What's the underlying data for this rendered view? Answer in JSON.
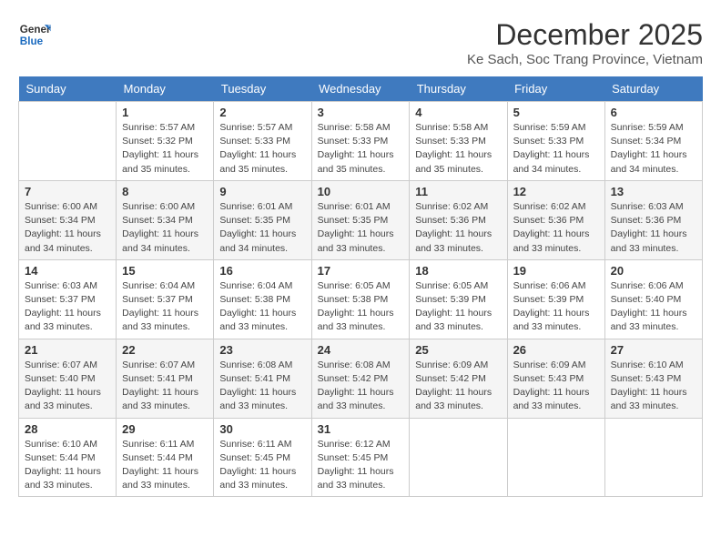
{
  "header": {
    "logo_general": "General",
    "logo_blue": "Blue",
    "month_title": "December 2025",
    "location": "Ke Sach, Soc Trang Province, Vietnam"
  },
  "weekdays": [
    "Sunday",
    "Monday",
    "Tuesday",
    "Wednesday",
    "Thursday",
    "Friday",
    "Saturday"
  ],
  "weeks": [
    [
      {
        "day": "",
        "sunrise": "",
        "sunset": "",
        "daylight": ""
      },
      {
        "day": "1",
        "sunrise": "Sunrise: 5:57 AM",
        "sunset": "Sunset: 5:32 PM",
        "daylight": "Daylight: 11 hours and 35 minutes."
      },
      {
        "day": "2",
        "sunrise": "Sunrise: 5:57 AM",
        "sunset": "Sunset: 5:33 PM",
        "daylight": "Daylight: 11 hours and 35 minutes."
      },
      {
        "day": "3",
        "sunrise": "Sunrise: 5:58 AM",
        "sunset": "Sunset: 5:33 PM",
        "daylight": "Daylight: 11 hours and 35 minutes."
      },
      {
        "day": "4",
        "sunrise": "Sunrise: 5:58 AM",
        "sunset": "Sunset: 5:33 PM",
        "daylight": "Daylight: 11 hours and 35 minutes."
      },
      {
        "day": "5",
        "sunrise": "Sunrise: 5:59 AM",
        "sunset": "Sunset: 5:33 PM",
        "daylight": "Daylight: 11 hours and 34 minutes."
      },
      {
        "day": "6",
        "sunrise": "Sunrise: 5:59 AM",
        "sunset": "Sunset: 5:34 PM",
        "daylight": "Daylight: 11 hours and 34 minutes."
      }
    ],
    [
      {
        "day": "7",
        "sunrise": "Sunrise: 6:00 AM",
        "sunset": "Sunset: 5:34 PM",
        "daylight": "Daylight: 11 hours and 34 minutes."
      },
      {
        "day": "8",
        "sunrise": "Sunrise: 6:00 AM",
        "sunset": "Sunset: 5:34 PM",
        "daylight": "Daylight: 11 hours and 34 minutes."
      },
      {
        "day": "9",
        "sunrise": "Sunrise: 6:01 AM",
        "sunset": "Sunset: 5:35 PM",
        "daylight": "Daylight: 11 hours and 34 minutes."
      },
      {
        "day": "10",
        "sunrise": "Sunrise: 6:01 AM",
        "sunset": "Sunset: 5:35 PM",
        "daylight": "Daylight: 11 hours and 33 minutes."
      },
      {
        "day": "11",
        "sunrise": "Sunrise: 6:02 AM",
        "sunset": "Sunset: 5:36 PM",
        "daylight": "Daylight: 11 hours and 33 minutes."
      },
      {
        "day": "12",
        "sunrise": "Sunrise: 6:02 AM",
        "sunset": "Sunset: 5:36 PM",
        "daylight": "Daylight: 11 hours and 33 minutes."
      },
      {
        "day": "13",
        "sunrise": "Sunrise: 6:03 AM",
        "sunset": "Sunset: 5:36 PM",
        "daylight": "Daylight: 11 hours and 33 minutes."
      }
    ],
    [
      {
        "day": "14",
        "sunrise": "Sunrise: 6:03 AM",
        "sunset": "Sunset: 5:37 PM",
        "daylight": "Daylight: 11 hours and 33 minutes."
      },
      {
        "day": "15",
        "sunrise": "Sunrise: 6:04 AM",
        "sunset": "Sunset: 5:37 PM",
        "daylight": "Daylight: 11 hours and 33 minutes."
      },
      {
        "day": "16",
        "sunrise": "Sunrise: 6:04 AM",
        "sunset": "Sunset: 5:38 PM",
        "daylight": "Daylight: 11 hours and 33 minutes."
      },
      {
        "day": "17",
        "sunrise": "Sunrise: 6:05 AM",
        "sunset": "Sunset: 5:38 PM",
        "daylight": "Daylight: 11 hours and 33 minutes."
      },
      {
        "day": "18",
        "sunrise": "Sunrise: 6:05 AM",
        "sunset": "Sunset: 5:39 PM",
        "daylight": "Daylight: 11 hours and 33 minutes."
      },
      {
        "day": "19",
        "sunrise": "Sunrise: 6:06 AM",
        "sunset": "Sunset: 5:39 PM",
        "daylight": "Daylight: 11 hours and 33 minutes."
      },
      {
        "day": "20",
        "sunrise": "Sunrise: 6:06 AM",
        "sunset": "Sunset: 5:40 PM",
        "daylight": "Daylight: 11 hours and 33 minutes."
      }
    ],
    [
      {
        "day": "21",
        "sunrise": "Sunrise: 6:07 AM",
        "sunset": "Sunset: 5:40 PM",
        "daylight": "Daylight: 11 hours and 33 minutes."
      },
      {
        "day": "22",
        "sunrise": "Sunrise: 6:07 AM",
        "sunset": "Sunset: 5:41 PM",
        "daylight": "Daylight: 11 hours and 33 minutes."
      },
      {
        "day": "23",
        "sunrise": "Sunrise: 6:08 AM",
        "sunset": "Sunset: 5:41 PM",
        "daylight": "Daylight: 11 hours and 33 minutes."
      },
      {
        "day": "24",
        "sunrise": "Sunrise: 6:08 AM",
        "sunset": "Sunset: 5:42 PM",
        "daylight": "Daylight: 11 hours and 33 minutes."
      },
      {
        "day": "25",
        "sunrise": "Sunrise: 6:09 AM",
        "sunset": "Sunset: 5:42 PM",
        "daylight": "Daylight: 11 hours and 33 minutes."
      },
      {
        "day": "26",
        "sunrise": "Sunrise: 6:09 AM",
        "sunset": "Sunset: 5:43 PM",
        "daylight": "Daylight: 11 hours and 33 minutes."
      },
      {
        "day": "27",
        "sunrise": "Sunrise: 6:10 AM",
        "sunset": "Sunset: 5:43 PM",
        "daylight": "Daylight: 11 hours and 33 minutes."
      }
    ],
    [
      {
        "day": "28",
        "sunrise": "Sunrise: 6:10 AM",
        "sunset": "Sunset: 5:44 PM",
        "daylight": "Daylight: 11 hours and 33 minutes."
      },
      {
        "day": "29",
        "sunrise": "Sunrise: 6:11 AM",
        "sunset": "Sunset: 5:44 PM",
        "daylight": "Daylight: 11 hours and 33 minutes."
      },
      {
        "day": "30",
        "sunrise": "Sunrise: 6:11 AM",
        "sunset": "Sunset: 5:45 PM",
        "daylight": "Daylight: 11 hours and 33 minutes."
      },
      {
        "day": "31",
        "sunrise": "Sunrise: 6:12 AM",
        "sunset": "Sunset: 5:45 PM",
        "daylight": "Daylight: 11 hours and 33 minutes."
      },
      {
        "day": "",
        "sunrise": "",
        "sunset": "",
        "daylight": ""
      },
      {
        "day": "",
        "sunrise": "",
        "sunset": "",
        "daylight": ""
      },
      {
        "day": "",
        "sunrise": "",
        "sunset": "",
        "daylight": ""
      }
    ]
  ]
}
